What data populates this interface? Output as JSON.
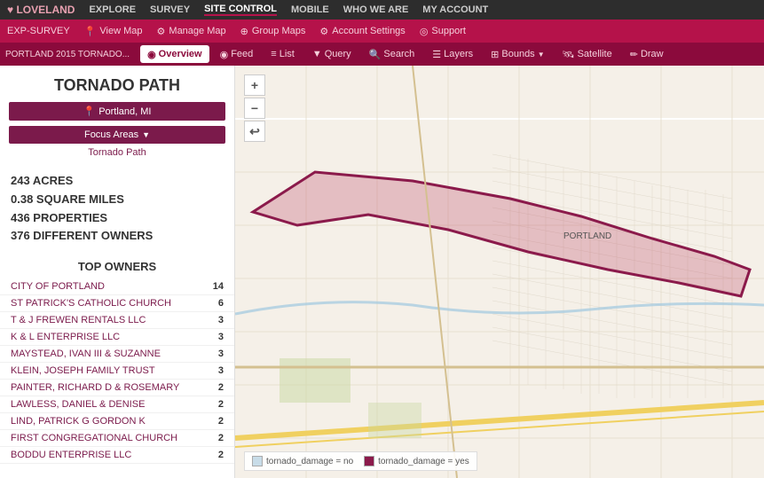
{
  "topNav": {
    "logo": "♥ LOVELAND",
    "items": [
      {
        "label": "EXPLORE",
        "active": false
      },
      {
        "label": "SURVEY",
        "active": false
      },
      {
        "label": "SITE CONTROL",
        "active": true
      },
      {
        "label": "MOBILE",
        "active": false
      },
      {
        "label": "WHO WE ARE",
        "active": false
      },
      {
        "label": "MY ACCOUNT",
        "active": false
      }
    ]
  },
  "secondNav": {
    "items": [
      {
        "label": "EXP-SURVEY",
        "icon": ""
      },
      {
        "label": "View Map",
        "icon": "📍"
      },
      {
        "label": "Manage Map",
        "icon": "⚙"
      },
      {
        "label": "Group Maps",
        "icon": "⊕"
      },
      {
        "label": "Account Settings",
        "icon": "⚙"
      },
      {
        "label": "Support",
        "icon": "◎"
      }
    ]
  },
  "thirdNav": {
    "breadcrumb": "PORTLAND 2015 TORNADO...",
    "tabs": [
      {
        "label": "Overview",
        "icon": "◉",
        "active": true
      },
      {
        "label": "Feed",
        "icon": "◉",
        "active": false
      },
      {
        "label": "List",
        "icon": "≡",
        "active": false
      },
      {
        "label": "Query",
        "icon": "▼",
        "active": false
      },
      {
        "label": "Search",
        "icon": "🔍",
        "active": false
      },
      {
        "label": "Layers",
        "icon": "☰",
        "active": false
      },
      {
        "label": "Bounds",
        "icon": "⊞",
        "active": false
      },
      {
        "label": "Satellite",
        "icon": "🛰",
        "active": false
      },
      {
        "label": "Draw",
        "icon": "✏",
        "active": false
      }
    ]
  },
  "sidebar": {
    "title": "TORNADO PATH",
    "location": "Portland, MI",
    "focusAreasLabel": "Focus Areas",
    "tornadoPathLink": "Tornado Path",
    "stats": [
      {
        "label": "243 ACRES"
      },
      {
        "label": "0.38 SQUARE MILES"
      },
      {
        "label": "436 PROPERTIES"
      },
      {
        "label": "376 DIFFERENT OWNERS"
      }
    ],
    "topOwnersTitle": "TOP OWNERS",
    "owners": [
      {
        "name": "CITY OF PORTLAND",
        "count": 14
      },
      {
        "name": "ST PATRICK'S CATHOLIC CHURCH",
        "count": 6
      },
      {
        "name": "T & J FREWEN RENTALS LLC",
        "count": 3
      },
      {
        "name": "K & L ENTERPRISE LLC",
        "count": 3
      },
      {
        "name": "MAYSTEAD, IVAN III & SUZANNE",
        "count": 3
      },
      {
        "name": "KLEIN, JOSEPH FAMILY TRUST",
        "count": 3
      },
      {
        "name": "PAINTER, RICHARD D & ROSEMARY",
        "count": 2
      },
      {
        "name": "LAWLESS, DANIEL & DENISE",
        "count": 2
      },
      {
        "name": "LIND, PATRICK G GORDON K",
        "count": 2
      },
      {
        "name": "FIRST CONGREGATIONAL CHURCH",
        "count": 2
      },
      {
        "name": "BODDU ENTERPRISE LLC",
        "count": 2
      }
    ]
  },
  "legend": {
    "items": [
      {
        "label": "tornado_damage = no",
        "color": "#c8dce8"
      },
      {
        "label": "tornado_damage = yes",
        "color": "#8b1a4b"
      }
    ]
  },
  "mapControls": {
    "zoomIn": "+",
    "zoomOut": "−",
    "back": "↩"
  }
}
